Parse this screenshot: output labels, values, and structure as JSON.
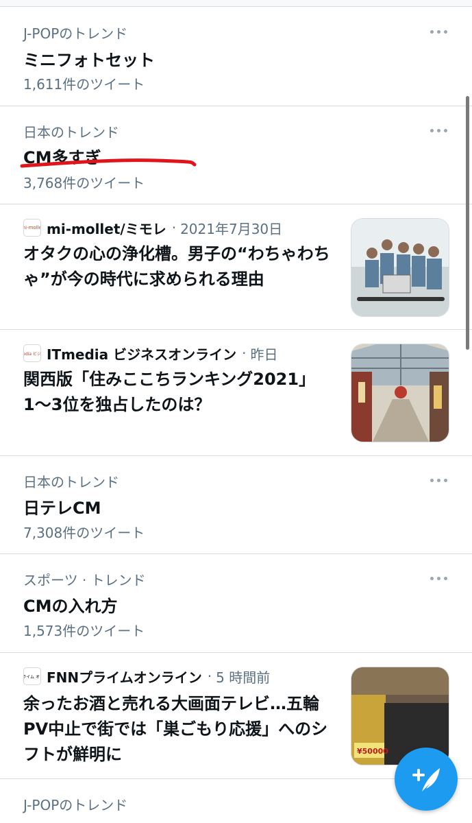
{
  "trends": [
    {
      "context": "J-POPのトレンド",
      "name": "ミニフォトセット",
      "count": "1,611件のツイート"
    },
    {
      "context": "日本のトレンド",
      "name": "CM多すぎ",
      "count": "3,768件のツイート"
    },
    {
      "context": "日本のトレンド",
      "name": "日テレCM",
      "count": "7,308件のツイート"
    },
    {
      "context": "スポーツ · トレンド",
      "name": "CMの入れ方",
      "count": "1,573件のツイート"
    },
    {
      "context": "J-POPのトレンド"
    }
  ],
  "news": [
    {
      "source": "mi-mollet/ミモレ",
      "logo_text": "mi-mollet",
      "time": "2021年7月30日",
      "headline": "オタクの心の浄化槽。男子の“わちゃわちゃ”が今の時代に求められる理由"
    },
    {
      "source": "ITmedia ビジネスオンライン",
      "logo_text": "ITmedia ビジネス",
      "time": "昨日",
      "headline": "関西版「住みここちランキング2021」1〜3位を独占したのは？"
    },
    {
      "source": "FNNプライムオンライン",
      "logo_text": "FNN プライム オンライン",
      "time": "5 時間前",
      "headline": "余ったお酒と売れる大画面テレビ…五輪PV中止で街では「巣ごもり応援」へのシフトが鮮明に",
      "thumb_price_text": "¥50000"
    }
  ],
  "separator": "·",
  "colors": {
    "accent": "#1d9bf0",
    "secondary_text": "#5b7083",
    "primary_text": "#0f1419",
    "annotation_underline": "#e0141b"
  },
  "icons": {
    "more": "more-dots-icon",
    "compose": "compose-feather-icon"
  }
}
